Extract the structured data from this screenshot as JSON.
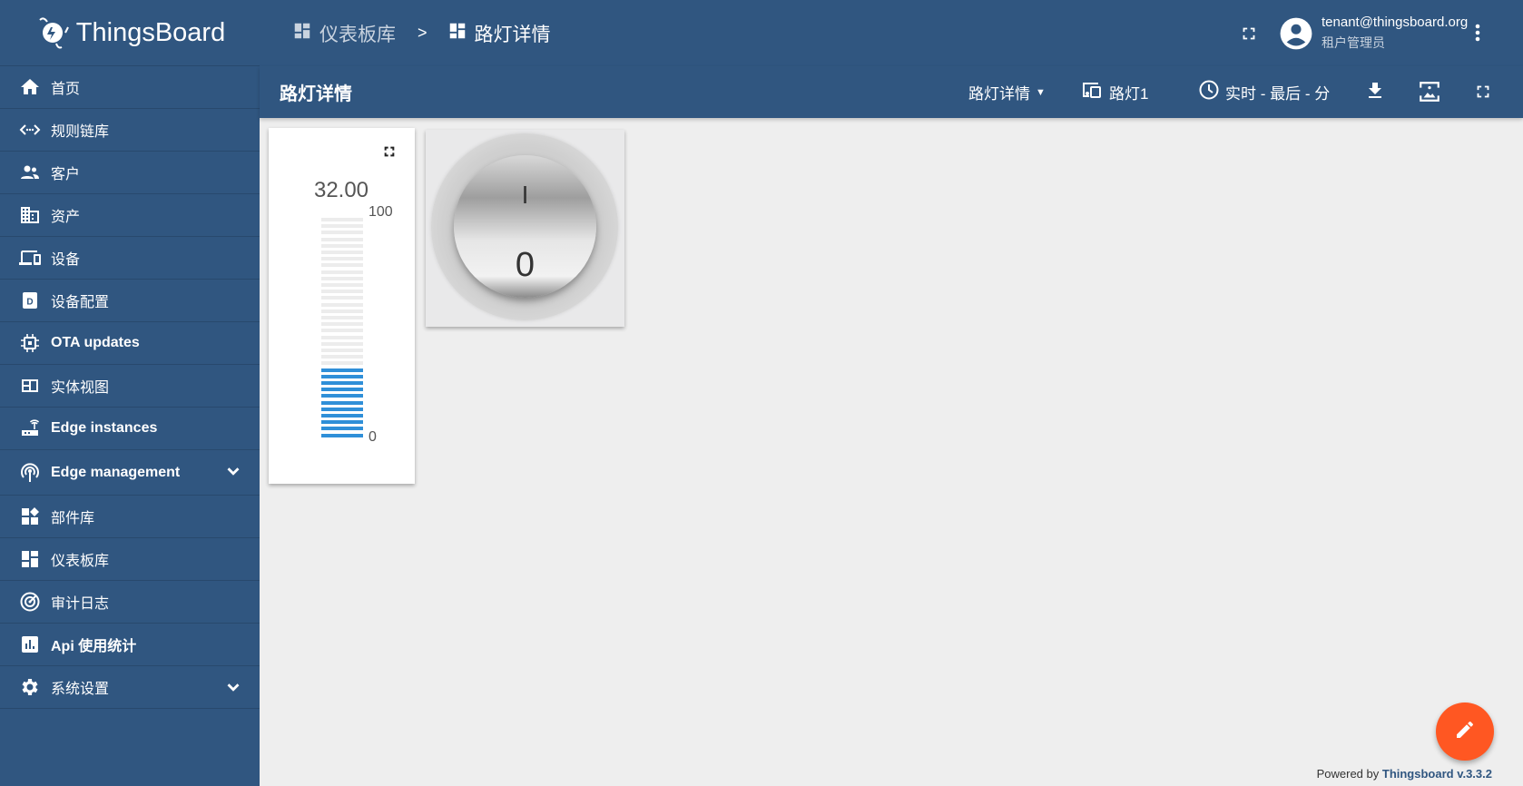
{
  "app": {
    "name": "ThingsBoard"
  },
  "sidebar": {
    "items": [
      {
        "label": "首页",
        "icon": "home-icon"
      },
      {
        "label": "规则链库",
        "icon": "rule-chain-icon"
      },
      {
        "label": "客户",
        "icon": "customers-icon"
      },
      {
        "label": "资产",
        "icon": "assets-icon"
      },
      {
        "label": "设备",
        "icon": "devices-icon"
      },
      {
        "label": "设备配置",
        "icon": "device-profile-icon"
      },
      {
        "label": "OTA updates",
        "icon": "chip-icon"
      },
      {
        "label": "实体视图",
        "icon": "entity-view-icon"
      },
      {
        "label": "Edge instances",
        "icon": "router-icon"
      },
      {
        "label": "Edge management",
        "icon": "antenna-icon",
        "expandable": true
      },
      {
        "label": "部件库",
        "icon": "widgets-icon"
      },
      {
        "label": "仪表板库",
        "icon": "dashboard-icon"
      },
      {
        "label": "审计日志",
        "icon": "audit-icon"
      },
      {
        "label": "Api 使用统计",
        "icon": "chart-icon"
      },
      {
        "label": "系统设置",
        "icon": "gear-icon",
        "expandable": true
      }
    ]
  },
  "header": {
    "breadcrumb": [
      "仪表板库",
      "路灯详情"
    ],
    "separator": ">",
    "user_email": "tenant@thingsboard.org",
    "user_role": "租户管理员"
  },
  "toolbar": {
    "title": "路灯详情",
    "state": "路灯详情",
    "entity": "路灯1",
    "timewindow": "实时 - 最后 - 分"
  },
  "widgets": {
    "gauge": {
      "value_text": "32.00",
      "value": 32,
      "min": 0,
      "max": 100,
      "min_label": "0",
      "max_label": "100",
      "color": "#2f8fd8"
    },
    "knob": {
      "on_label": "I",
      "off_label": "0"
    }
  },
  "footer": {
    "powered_prefix": "Powered by",
    "powered_link": "Thingsboard v.3.3.2"
  }
}
